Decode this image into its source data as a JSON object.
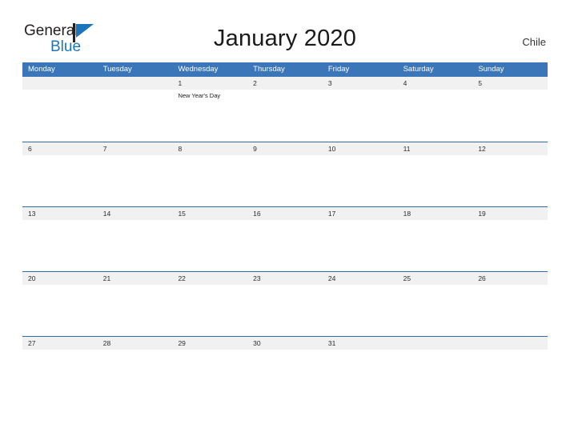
{
  "brand": {
    "name_part1": "General",
    "name_part2": "Blue",
    "flag_icon": "blue-triangle-flag-icon",
    "color_dark": "#231f20",
    "color_blue": "#1b75bb"
  },
  "header": {
    "title": "January 2020",
    "country": "Chile"
  },
  "theme": {
    "header_blue": "#3a76b8",
    "row_rule_blue": "#2e6ca8",
    "date_band_gray": "#f1f1f1",
    "page_background": "#ffffff"
  },
  "calendar": {
    "month": "January",
    "year": "2020",
    "weekday_headers": [
      "Monday",
      "Tuesday",
      "Wednesday",
      "Thursday",
      "Friday",
      "Saturday",
      "Sunday"
    ],
    "weeks": [
      [
        {
          "day": "",
          "event": ""
        },
        {
          "day": "",
          "event": ""
        },
        {
          "day": "1",
          "event": "New Year's Day"
        },
        {
          "day": "2",
          "event": ""
        },
        {
          "day": "3",
          "event": ""
        },
        {
          "day": "4",
          "event": ""
        },
        {
          "day": "5",
          "event": ""
        }
      ],
      [
        {
          "day": "6",
          "event": ""
        },
        {
          "day": "7",
          "event": ""
        },
        {
          "day": "8",
          "event": ""
        },
        {
          "day": "9",
          "event": ""
        },
        {
          "day": "10",
          "event": ""
        },
        {
          "day": "11",
          "event": ""
        },
        {
          "day": "12",
          "event": ""
        }
      ],
      [
        {
          "day": "13",
          "event": ""
        },
        {
          "day": "14",
          "event": ""
        },
        {
          "day": "15",
          "event": ""
        },
        {
          "day": "16",
          "event": ""
        },
        {
          "day": "17",
          "event": ""
        },
        {
          "day": "18",
          "event": ""
        },
        {
          "day": "19",
          "event": ""
        }
      ],
      [
        {
          "day": "20",
          "event": ""
        },
        {
          "day": "21",
          "event": ""
        },
        {
          "day": "22",
          "event": ""
        },
        {
          "day": "23",
          "event": ""
        },
        {
          "day": "24",
          "event": ""
        },
        {
          "day": "25",
          "event": ""
        },
        {
          "day": "26",
          "event": ""
        }
      ],
      [
        {
          "day": "27",
          "event": ""
        },
        {
          "day": "28",
          "event": ""
        },
        {
          "day": "29",
          "event": ""
        },
        {
          "day": "30",
          "event": ""
        },
        {
          "day": "31",
          "event": ""
        },
        {
          "day": "",
          "event": ""
        },
        {
          "day": "",
          "event": ""
        }
      ]
    ]
  }
}
